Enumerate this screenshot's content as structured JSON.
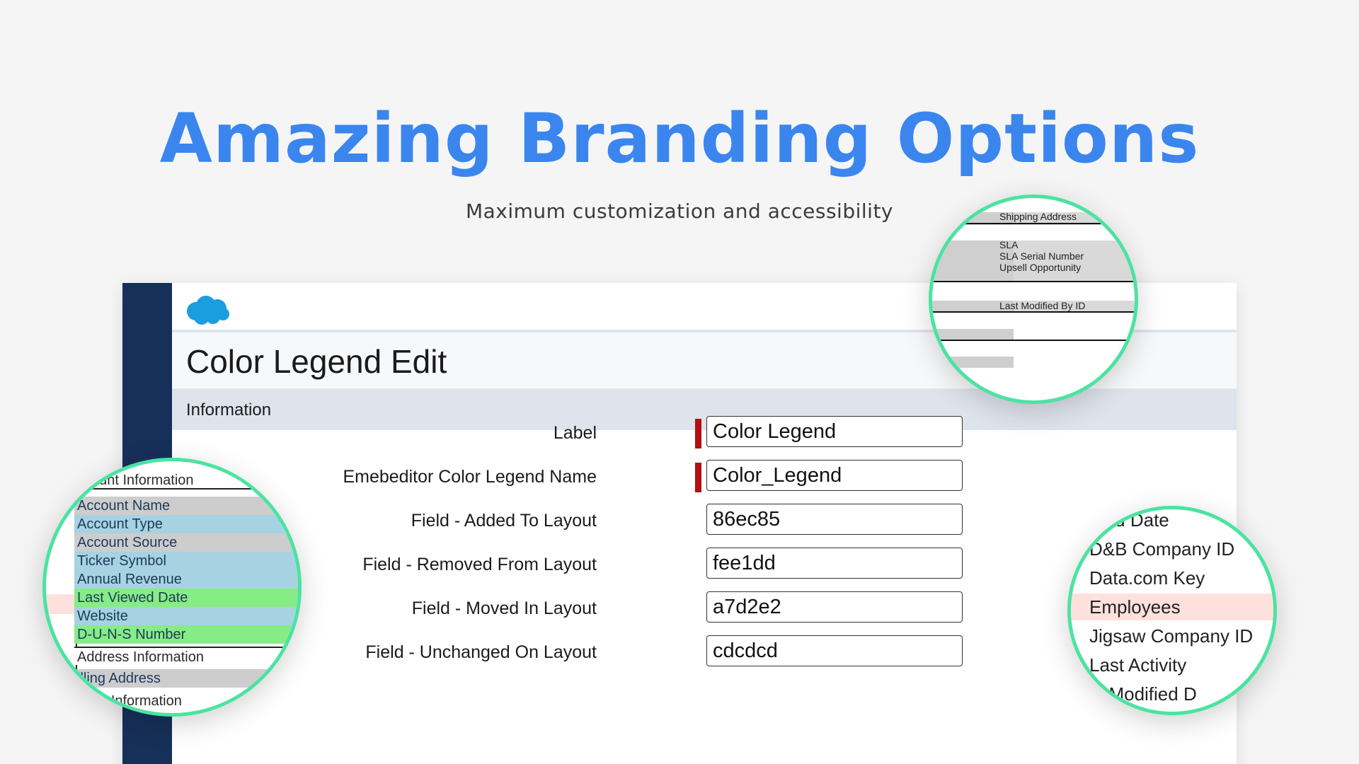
{
  "hero": {
    "title": "Amazing Branding Options",
    "subtitle": "Maximum customization and accessibility"
  },
  "colors": {
    "accent": "#3a86ee",
    "rail": "#17305a",
    "magnifier_border": "#4be3a1",
    "required_marker": "#b60f0f",
    "added": "#86ec85",
    "removed": "#fee1dd",
    "moved": "#a7d2e2",
    "unchanged": "#cdcdcd"
  },
  "app": {
    "logo": "salesforce-cloud-icon",
    "page_title": "Color Legend Edit",
    "section_label": "Information",
    "fields": [
      {
        "label": "Label",
        "value": "Color Legend",
        "required": true
      },
      {
        "label": "Emebeditor Color Legend Name",
        "value": "Color_Legend",
        "required": true
      },
      {
        "label": "Field - Added To Layout",
        "value": "86ec85",
        "required": false
      },
      {
        "label": "Field - Removed From Layout",
        "value": "fee1dd",
        "required": false
      },
      {
        "label": "Field - Moved In Layout",
        "value": "a7d2e2",
        "required": false
      },
      {
        "label": "Field - Unchanged On Layout",
        "value": "cdcdcd",
        "required": false
      }
    ]
  },
  "magnifiers": {
    "top_right": {
      "rows": [
        "Shipping Address",
        "SLA",
        "SLA Serial Number",
        "Upsell Opportunity",
        "Last Modified By ID"
      ]
    },
    "left": {
      "rows": [
        {
          "text": "ccount Information",
          "status": "header"
        },
        {
          "text": "Account Name",
          "status": "unchanged"
        },
        {
          "text": "Account Type",
          "status": "moved"
        },
        {
          "text": "Account Source",
          "status": "unchanged"
        },
        {
          "text": "Ticker Symbol",
          "status": "moved"
        },
        {
          "text": "Annual Revenue",
          "status": "moved"
        },
        {
          "text": "Last Viewed Date",
          "status": "added"
        },
        {
          "text": "Website",
          "status": "moved"
        },
        {
          "text": "D-U-N-S Number",
          "status": "added"
        },
        {
          "text": "Address Information",
          "status": "header"
        },
        {
          "text": "illing Address",
          "status": "unchanged"
        },
        {
          "text": "ional Information",
          "status": "header"
        }
      ]
    },
    "bottom_right": {
      "rows": [
        {
          "text": "ated Date",
          "status": "none"
        },
        {
          "text": "D&B Company ID",
          "status": "none"
        },
        {
          "text": "Data.com Key",
          "status": "none"
        },
        {
          "text": "Employees",
          "status": "removed"
        },
        {
          "text": "Jigsaw Company ID",
          "status": "none"
        },
        {
          "text": "Last Activity",
          "status": "none"
        },
        {
          "text": "st Modified D",
          "status": "none"
        }
      ]
    }
  }
}
